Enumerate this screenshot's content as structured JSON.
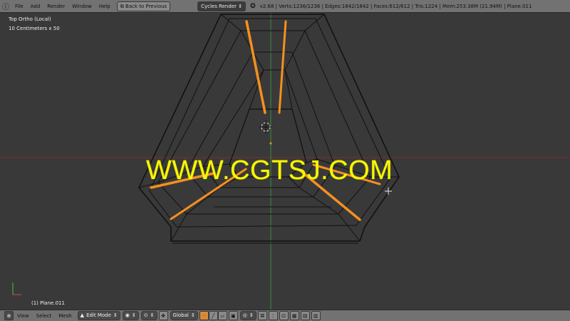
{
  "header": {
    "menus": [
      "File",
      "Add",
      "Render",
      "Window",
      "Help"
    ],
    "back_button": "Back to Previous",
    "render_engine": "Cycles Render",
    "stats": "v2.68 | Verts:1236/1236 | Edges:1842/1842 | Faces:612/612 | Tris:1224 | Mem:253.38M (21.94M) | Plane.011"
  },
  "viewport": {
    "view_name": "Top Ortho (Local)",
    "grid_scale": "10 Centimeters x 50",
    "watermark": "WWW.CGTSJ.COM",
    "object_label": "(1) Plane.011"
  },
  "footer": {
    "menus": [
      "View",
      "Select",
      "Mesh"
    ],
    "mode": "Edit Mode",
    "orientation": "Global"
  },
  "colors": {
    "viewport_bg": "#393939",
    "wire": "#111111",
    "selected_edges": "#f5901e",
    "watermark": "#f7f700",
    "header_bg": "#727272"
  }
}
